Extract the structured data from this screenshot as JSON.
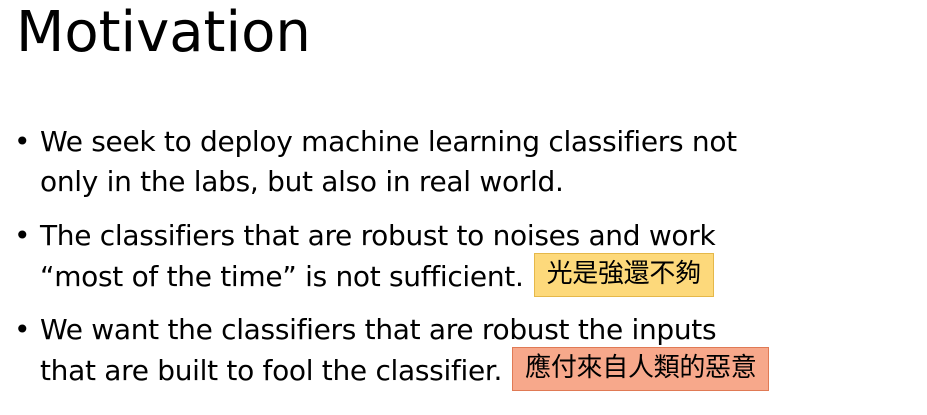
{
  "slide": {
    "title": "Motivation",
    "bullets": [
      {
        "lines": [
          "We seek to deploy machine learning classifiers not",
          "only in the labs, but also in real world."
        ]
      },
      {
        "lines": [
          "The classifiers that are robust to noises and work",
          "“most of the time” is not sufficient."
        ],
        "note": "光是強還不夠",
        "note_color": "#fdd97b"
      },
      {
        "lines": [
          "We want the classifiers that are robust the inputs",
          "that are built to fool the classifier."
        ],
        "note": "應付來自人類的惡意",
        "note_color": "#f7a88b"
      }
    ]
  }
}
